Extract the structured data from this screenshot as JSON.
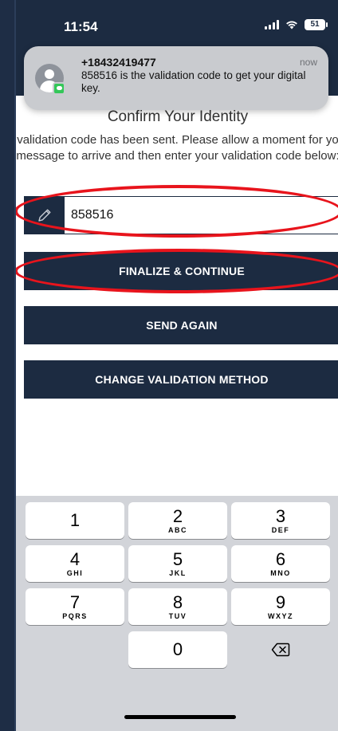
{
  "status_bar": {
    "time": "11:54",
    "battery": "51"
  },
  "notification": {
    "sender": "+18432419477",
    "time": "now",
    "message": "858516 is the validation code to get your digital key."
  },
  "page": {
    "title": "Confirm Your Identity",
    "description": "A validation code has been sent. Please allow a moment for your message to arrive and then enter your validation code below:"
  },
  "code_field": {
    "value": "858516"
  },
  "buttons": {
    "finalize": "FINALIZE & CONTINUE",
    "send_again": "SEND AGAIN",
    "change_method": "CHANGE VALIDATION METHOD"
  },
  "keypad": {
    "k1": {
      "num": "1",
      "letters": ""
    },
    "k2": {
      "num": "2",
      "letters": "ABC"
    },
    "k3": {
      "num": "3",
      "letters": "DEF"
    },
    "k4": {
      "num": "4",
      "letters": "GHI"
    },
    "k5": {
      "num": "5",
      "letters": "JKL"
    },
    "k6": {
      "num": "6",
      "letters": "MNO"
    },
    "k7": {
      "num": "7",
      "letters": "PQRS"
    },
    "k8": {
      "num": "8",
      "letters": "TUV"
    },
    "k9": {
      "num": "9",
      "letters": "WXYZ"
    },
    "k0": {
      "num": "0"
    },
    "delete_icon": "backspace-icon"
  },
  "colors": {
    "navy": "#1c2b41",
    "annotation_red": "#e8141c"
  }
}
